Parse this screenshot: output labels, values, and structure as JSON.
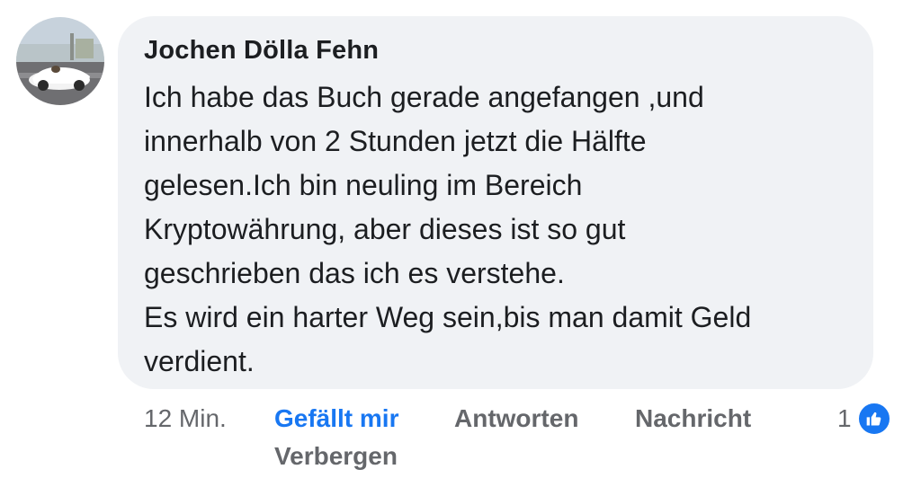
{
  "comment": {
    "author": "Jochen Dölla Fehn",
    "text_lines": [
      "Ich habe das Buch gerade angefangen ,und",
      "innerhalb von 2 Stunden jetzt die Hälfte",
      "gelesen.Ich bin neuling im Bereich",
      "Kryptowährung, aber dieses ist so gut",
      "geschrieben das ich es verstehe.",
      "Es wird ein harter Weg sein,bis man damit Geld",
      "verdient."
    ]
  },
  "actions": {
    "timestamp": "12 Min.",
    "like_label": "Gefällt mir",
    "reply_label": "Antworten",
    "message_label": "Nachricht",
    "hide_label": "Verbergen"
  },
  "reactions": {
    "count": "1",
    "icon": "thumbs-up-icon"
  },
  "colors": {
    "bubble_bg": "#f0f2f5",
    "accent": "#1877f2",
    "secondary_text": "#65676b",
    "primary_text": "#1c1e21"
  }
}
